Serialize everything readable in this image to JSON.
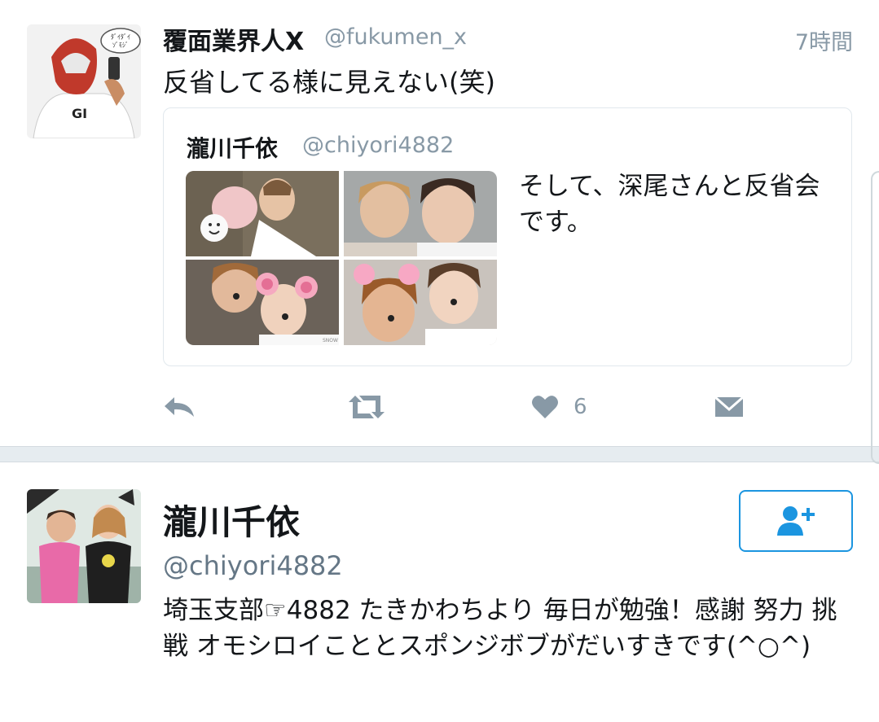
{
  "tweet": {
    "author_name": "覆面業界人X",
    "author_handle": "@fukumen_x",
    "time": "7時間",
    "text": "反省してる様に見えない(笑)",
    "avatar_speech": "ﾀﾞｲﾀﾞｲ\nｿﾞﾓｼﾞ",
    "quoted": {
      "author_name": "瀧川千依",
      "author_handle": "@chiyori4882",
      "text": "そして、深尾さんと反省会です。",
      "photo_watermark": "SNOW"
    },
    "actions": {
      "reply_icon": "reply-icon",
      "retweet_icon": "retweet-icon",
      "like_icon": "heart-icon",
      "like_count": "6",
      "dm_icon": "envelope-icon"
    }
  },
  "profile": {
    "name": "瀧川千依",
    "handle": "@chiyori4882",
    "bio": "埼玉支部☞4882 たきかわちより 毎日が勉強！感謝 努力 挑戦 オモシロイこととスポンジボブがだいすきです(^○^)",
    "follow_icon": "add-user-icon"
  },
  "colors": {
    "accent": "#1b95e0",
    "secondary_text": "#8899a6",
    "separator": "#e6ecf0"
  }
}
